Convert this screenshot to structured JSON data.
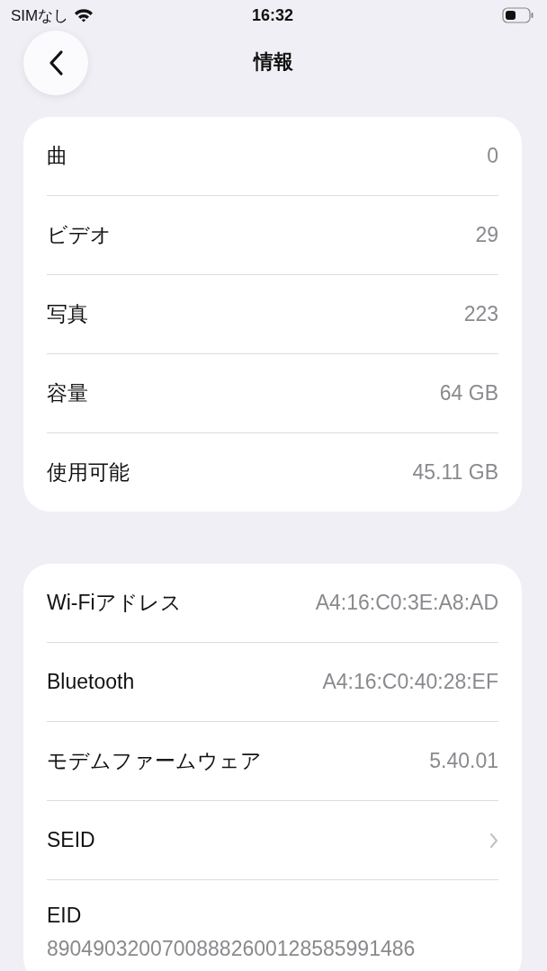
{
  "status_bar": {
    "carrier": "SIMなし",
    "time": "16:32"
  },
  "nav": {
    "title": "情報"
  },
  "sections": [
    {
      "rows": [
        {
          "kind": "value",
          "label": "曲",
          "value": "0"
        },
        {
          "kind": "value",
          "label": "ビデオ",
          "value": "29"
        },
        {
          "kind": "value",
          "label": "写真",
          "value": "223"
        },
        {
          "kind": "value",
          "label": "容量",
          "value": "64 GB"
        },
        {
          "kind": "value",
          "label": "使用可能",
          "value": "45.11 GB"
        }
      ]
    },
    {
      "rows": [
        {
          "kind": "value",
          "label": "Wi-Fiアドレス",
          "value": "A4:16:C0:3E:A8:AD"
        },
        {
          "kind": "value",
          "label": "Bluetooth",
          "value": "A4:16:C0:40:28:EF"
        },
        {
          "kind": "value",
          "label": "モデムファームウェア",
          "value": "5.40.01"
        },
        {
          "kind": "link",
          "label": "SEID"
        },
        {
          "kind": "stacked",
          "label": "EID",
          "value": "89049032007008882600128585991486"
        }
      ]
    }
  ]
}
